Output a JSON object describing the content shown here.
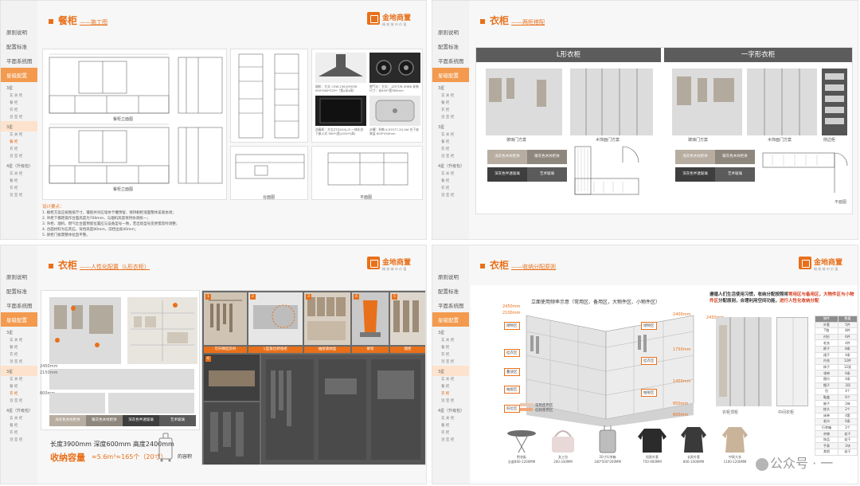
{
  "sidebar": {
    "items": [
      "原则说明",
      "配置标准",
      "平面系统图",
      "星级配置"
    ],
    "sub_groups": [
      {
        "head": "3星",
        "items": [
          "玄 关 柜",
          "餐 柜",
          "衣 柜",
          "浴 室 柜"
        ]
      },
      {
        "head": "3星",
        "items": [
          "玄 关 柜",
          "餐 柜",
          "衣 柜",
          "浴 室 柜"
        ]
      },
      {
        "head": "4星（升级包）",
        "items": [
          "玄 关 柜",
          "餐 柜",
          "衣 柜",
          "浴 室 柜"
        ]
      }
    ]
  },
  "logo": {
    "name": "金地商置",
    "tagline": "精 筑 城 市 价 值"
  },
  "slide1": {
    "title": "餐柜",
    "subtitle": "——施工图",
    "captions": [
      "餐柜立面图",
      "台面图",
      "平面图",
      "剖面图"
    ],
    "hood_spec": "烟机：方太 CXW-258-EM03B 900*580*525*（宽x深x高）",
    "stove_spec": "燃气灶：方太：-JZY/T/R-3HB8 安装尺寸：长655*宽385mm",
    "oven_spec": "消毒柜：方太ZTD100J-J3 一体化台下嵌入式 560*(宽)x550*(高)",
    "sink_spec": "水槽：科勒 K-97577-2Q-NA 台下安装盆 800*450mm",
    "notes_title": "设计要点：",
    "notes": [
      "1. 橱柜方案应按图纸尺寸，镶嵌并对应墙体卡槽预留，保持橱柜墙面整体美观协调；",
      "2. 吊柜下檐距操作台面高度为700mm，与烟机高度保持协调统一；",
      "3. 吊柜、烟机、燃气灶台面预留位置应与设备型号一致，若出现型号变更需及时调整；",
      "4. 台面材料为石英石，背挡高度80mm，前挡边高40mm；",
      "5. 厨柜门板需整体拉直平整。"
    ]
  },
  "slide2": {
    "title": "衣柜",
    "subtitle": "——两柜搭配",
    "tabs": [
      "L形衣柜",
      "一字形衣柜"
    ],
    "captions_left": [
      "玻璃门方案",
      "木饰面门方案"
    ],
    "captions_right": [
      "玻璃门方案",
      "木饰面门方案",
      "侧边柜"
    ],
    "swatches": [
      "浅灰色木纹柜体",
      "暖灰色木纹柜体",
      "深灰色半透玻璃",
      "艺术玻璃"
    ],
    "plan_label": "平面图"
  },
  "slide3": {
    "title": "衣柜",
    "subtitle": "——人性化配置（L形衣柜）",
    "swatches": [
      "浅灰色木纹柜体",
      "暖灰色木纹柜体",
      "深灰色半透玻璃",
      "艺术玻璃"
    ],
    "photo_tags": [
      "1",
      "2",
      "3",
      "4",
      "5",
      "6"
    ],
    "photo_captions": [
      "可升降挂衣杆",
      "L型角位转角柜",
      "抽屉收纳盒",
      "裤架",
      "镜柜"
    ],
    "dims": [
      "2450mm",
      "2150mm",
      "800mm"
    ],
    "spec_line": "长度3900mm  深度600mm  高度2400mm",
    "capacity_label": "收纳容量",
    "capacity_value": "≈5.6m³≈165个（20寸）",
    "capacity_unit": "的容积"
  },
  "slide4": {
    "title": "衣柜",
    "subtitle": "——收纳分配原则",
    "diagram_title": "立面使用频率示意（常用区、备用区，大物件区、小物件区）",
    "headline_1": "遵循人们生活使用习惯，收纳分配按照将",
    "headline_hl": "常用区与备用区，大物件区与小物件区",
    "headline_2": "分配原则，合理利用空间功能，",
    "headline_hl2": "进行人性化收纳分配",
    "dims": [
      "2450mm",
      "2400mm",
      "2100mm",
      "1750mm",
      "1450mm",
      "850mm",
      "600mm",
      "2450mm"
    ],
    "zone_tags": [
      "储物区",
      "挂衣区",
      "叠放区",
      "抽屉区",
      "低位区"
    ],
    "table_header": [
      "物件",
      "数量"
    ],
    "table_rows": [
      [
        "外套",
        "5件"
      ],
      [
        "T恤",
        "8件"
      ],
      [
        "衬衫",
        "6件"
      ],
      [
        "毛衣",
        "4件"
      ],
      [
        "裤子",
        "8条"
      ],
      [
        "裙子",
        "4条"
      ],
      [
        "内衣",
        "12件"
      ],
      [
        "袜子",
        "12双"
      ],
      [
        "领带",
        "6条"
      ],
      [
        "围巾",
        "4条"
      ],
      [
        "帽子",
        "3顶"
      ],
      [
        "包",
        "4个"
      ],
      [
        "鞋盒",
        "6个"
      ],
      [
        "被子",
        "2床"
      ],
      [
        "枕头",
        "2个"
      ],
      [
        "床单",
        "4套"
      ],
      [
        "毛巾",
        "6条"
      ],
      [
        "行李箱",
        "2个"
      ],
      [
        "杂物",
        "若干"
      ],
      [
        "饰品",
        "若干"
      ],
      [
        "手表",
        "2块"
      ],
      [
        "其他",
        "若干"
      ]
    ],
    "items": [
      {
        "name": "熨衣板",
        "dim": "长度800-1200MM"
      },
      {
        "name": "女士包",
        "dim": "200-330MM"
      },
      {
        "name": "20寸行李箱",
        "dim": "340*500*200MM"
      },
      {
        "name": "短款外套",
        "dim": "750-900MM"
      },
      {
        "name": "长款外套",
        "dim": "800-1000MM"
      },
      {
        "name": "中款大衣",
        "dim": "1100-1200MM"
      }
    ],
    "legend": [
      "常用使用区",
      "低频使用区"
    ],
    "bottom_text": [
      "衣柜顶柜",
      "中间衣柜"
    ],
    "watermark": "公众号 · 一"
  }
}
